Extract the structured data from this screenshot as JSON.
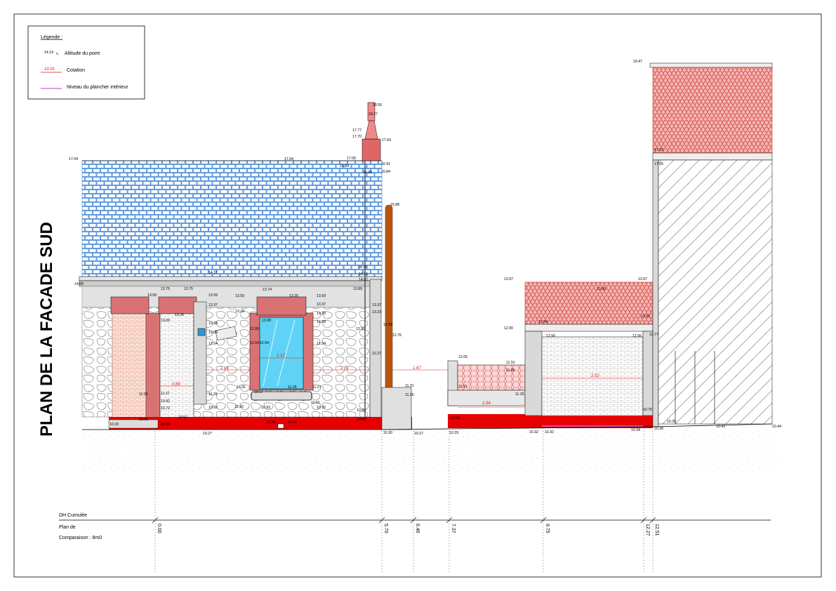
{
  "title": "PLAN DE LA FACADE SUD",
  "legend": {
    "heading": "Légende :",
    "items": [
      {
        "sample": "14.19",
        "label": "Altitude du point"
      },
      {
        "sample": "10.91",
        "label": "Cotation"
      },
      {
        "sample": "",
        "label": "Niveau du plancher intérieur"
      }
    ]
  },
  "altitudes": [
    "19.47",
    "18.50",
    "18.27",
    "17.77",
    "17.70",
    "17.59",
    "17.04",
    "17.04",
    "17.05",
    "16.84",
    "16.83",
    "16.91",
    "16.84",
    "17.23",
    "17.05",
    "15.88",
    "14.17",
    "14.00",
    "14.30",
    "14.16",
    "14.02",
    "13.89",
    "13.75",
    "13.75",
    "13.59",
    "13.26",
    "13.59",
    "13.37",
    "13.09",
    "12.88",
    "13.09",
    "12.54",
    "13.74",
    "13.59",
    "13.25",
    "13.59",
    "13.37",
    "13.29",
    "13.28",
    "13.08",
    "12.89",
    "13.08",
    "12.54",
    "12.54",
    "12.54",
    "13.37",
    "13.23",
    "12.90",
    "12.99",
    "12.76",
    "12.27",
    "13.97",
    "13.97",
    "13.90",
    "12.94",
    "13.02",
    "12.90",
    "12.56",
    "12.56",
    "12.77",
    "12.05",
    "11.91",
    "11.85",
    "11.31",
    "11.26",
    "11.31",
    "11.26",
    "11.25",
    "11.27",
    "10.92",
    "10.72",
    "11.26",
    "10.92",
    "10.52",
    "11.26",
    "11.17",
    "11.26",
    "11.27",
    "10.92",
    "10.92",
    "11.01",
    "10.92",
    "10.69",
    "10.60",
    "10.33",
    "10.34",
    "10.60",
    "10.27",
    "10.45",
    "10.41",
    "10.30",
    "10.27",
    "10.29",
    "10.45",
    "10.32",
    "10.32",
    "10.34",
    "10.70",
    "10.38",
    "10.39",
    "10.43",
    "10.44"
  ],
  "dimensions": [
    "0.89",
    "1.16",
    "1.12",
    "1.71",
    "1.67",
    "1.94",
    "2.52"
  ],
  "footer": {
    "dh_label": "DH Cumulée",
    "plan_label": "Plan de",
    "comparaison_label": "Comparaison : 8m0",
    "chainages": [
      "0.00",
      "5.70",
      "6.46",
      "7.37",
      "9.75",
      "12.27",
      "12.51"
    ]
  },
  "colors": {
    "red_band": "#e60000",
    "tile_pink": "#f7a7a7",
    "slate_blue": "#3b82d6",
    "glass_blue": "#5fd3f5",
    "pipe_brown": "#b8560f",
    "wall_gray": "#d9d9d9",
    "floor_violet": "#cc66cc",
    "brick": "#d97373"
  }
}
